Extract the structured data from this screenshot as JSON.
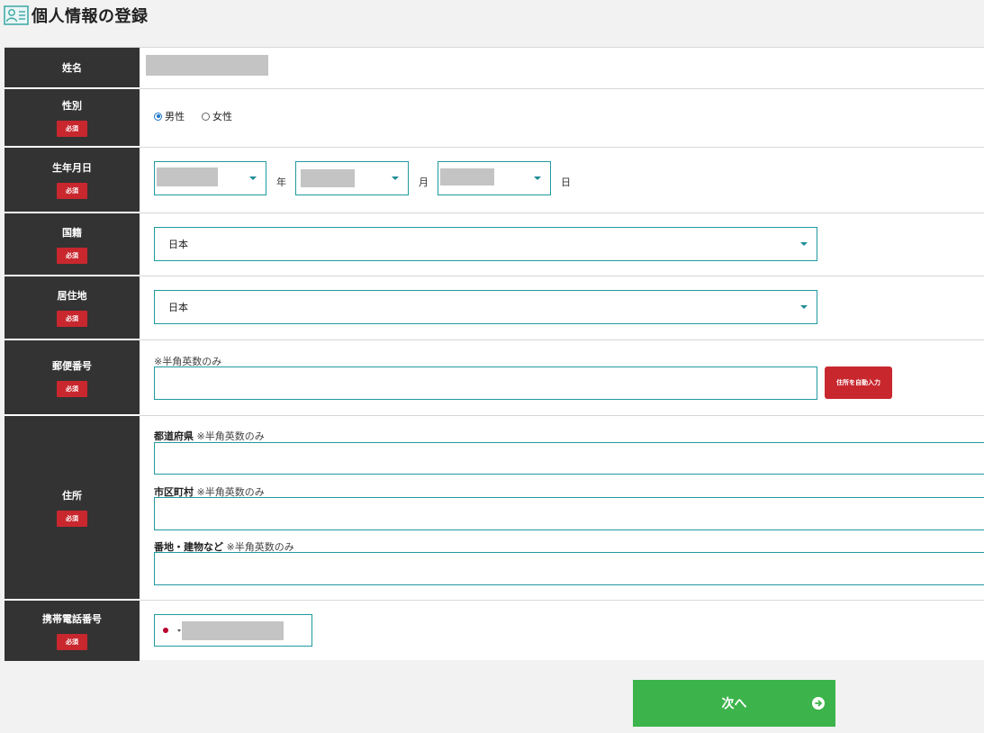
{
  "header": {
    "title": "個人情報の登録",
    "icon": "person-card-icon"
  },
  "colors": {
    "label_bg": "#333333",
    "required_badge": "#c8272e",
    "input_border": "#1f9aa0",
    "next_button": "#3cb44b"
  },
  "form": {
    "required_badge": "必須",
    "name": {
      "label": "姓名"
    },
    "gender": {
      "label": "性別",
      "options": [
        "男性",
        "女性"
      ],
      "selected": "男性"
    },
    "birthdate": {
      "label": "生年月日",
      "year_unit": "年",
      "month_unit": "月",
      "day_unit": "日"
    },
    "nationality": {
      "label": "国籍",
      "value": "日本"
    },
    "residence": {
      "label": "居住地",
      "value": "日本"
    },
    "postal": {
      "label": "郵便番号",
      "hint": "※半角英数のみ",
      "auto_button": "住所を自動入力"
    },
    "address": {
      "label": "住所",
      "prefecture_label": "都道府県",
      "city_label": "市区町村",
      "street_label": "番地・建物など",
      "hint": "※半角英数のみ"
    },
    "phone": {
      "label": "携帯電話番号",
      "flag": "Japan"
    }
  },
  "footer": {
    "next_button": "次へ"
  }
}
